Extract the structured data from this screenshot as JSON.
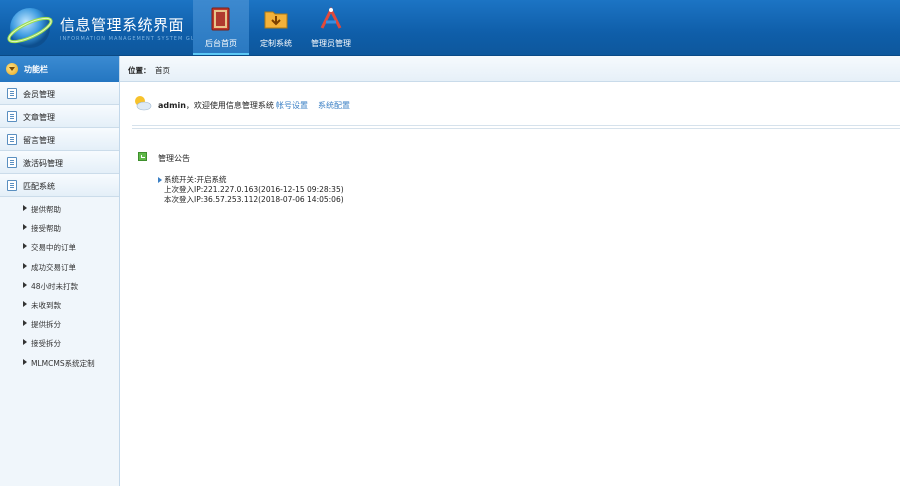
{
  "app": {
    "title": "信息管理系统界面",
    "subtitle": "INFORMATION MANAGEMENT SYSTEM GUI"
  },
  "nav": {
    "items": [
      {
        "label": "后台首页",
        "icon": "book-icon",
        "active": true
      },
      {
        "label": "定制系统",
        "icon": "folder-download-icon",
        "active": false
      },
      {
        "label": "管理员管理",
        "icon": "tools-icon",
        "active": false
      }
    ]
  },
  "sidebar": {
    "header": "功能栏",
    "items": [
      {
        "label": "会员管理"
      },
      {
        "label": "文章管理"
      },
      {
        "label": "留言管理"
      },
      {
        "label": "激活码管理"
      },
      {
        "label": "匹配系统"
      }
    ],
    "sub_items": [
      {
        "label": "提供帮助"
      },
      {
        "label": "接受帮助"
      },
      {
        "label": "交易中的订单"
      },
      {
        "label": "成功交易订单"
      },
      {
        "label": "48小时未打款"
      },
      {
        "label": "未收到款"
      },
      {
        "label": "提供拆分"
      },
      {
        "label": "接受拆分"
      },
      {
        "label": "MLMCMS系统定制"
      }
    ]
  },
  "breadcrumb": {
    "label": "位置：",
    "value": "首页"
  },
  "welcome": {
    "user": "admin",
    "message": "，欢迎使用信息管理系统",
    "link_account": "帐号设置",
    "link_config": "系统配置"
  },
  "notice": {
    "title": "管理公告",
    "lines": [
      "系统开关:开启系统",
      "上次登入IP:221.227.0.163(2016-12-15 09:28:35)",
      "本次登入IP:36.57.253.112(2018-07-06 14:05:06)"
    ]
  },
  "colors": {
    "header_bg": "#0f5ea9",
    "accent": "#5bc8f5",
    "link": "#3a7fc4"
  }
}
